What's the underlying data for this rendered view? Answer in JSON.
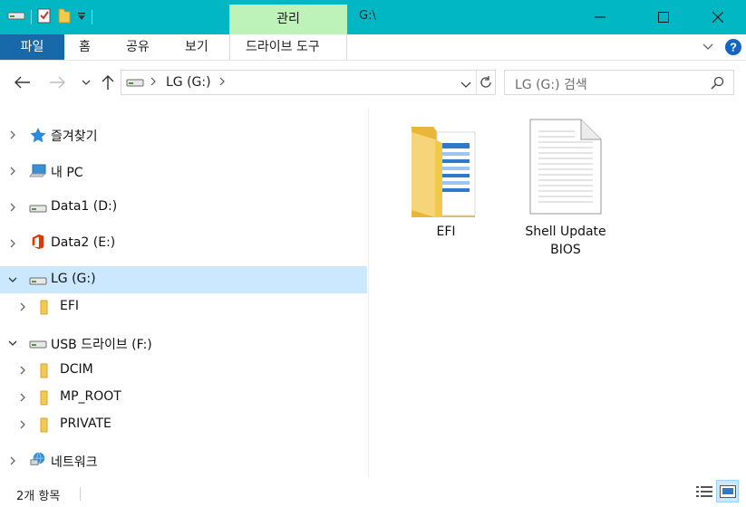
{
  "window": {
    "title": "G:\\",
    "context_tab": "관리",
    "minimize_glyph": "—",
    "maximize_glyph": "☐",
    "close_glyph": "✕"
  },
  "ribbon": {
    "file_tab": "파일",
    "tabs": [
      "홈",
      "공유",
      "보기"
    ],
    "context_subtab": "드라이브 도구"
  },
  "address": {
    "path": "LG (G:)",
    "search_placeholder": "LG (G:) 검색"
  },
  "nav": {
    "items": [
      {
        "label": "즐겨찾기",
        "icon": "star-icon",
        "expanded": false
      },
      {
        "label": "내 PC",
        "icon": "pc-icon",
        "expanded": false
      },
      {
        "label": "Data1 (D:)",
        "icon": "drive-icon",
        "expanded": false
      },
      {
        "label": "Data2 (E:)",
        "icon": "office-icon",
        "expanded": false
      },
      {
        "label": "LG (G:)",
        "icon": "drive-icon",
        "expanded": true,
        "selected": true
      },
      {
        "label": "EFI",
        "icon": "folder-icon",
        "expanded": false,
        "child": true
      },
      {
        "label": "USB 드라이브 (F:)",
        "icon": "drive-icon",
        "expanded": true
      },
      {
        "label": "DCIM",
        "icon": "folder-icon",
        "expanded": false,
        "child": true
      },
      {
        "label": "MP_ROOT",
        "icon": "folder-icon",
        "expanded": false,
        "child": true
      },
      {
        "label": "PRIVATE",
        "icon": "folder-icon",
        "expanded": false,
        "child": true
      },
      {
        "label": "네트워크",
        "icon": "network-icon",
        "expanded": false
      }
    ]
  },
  "content": {
    "files": [
      {
        "name": "EFI",
        "type": "folder"
      },
      {
        "name_line1": "Shell Update",
        "name_line2": "BIOS",
        "type": "file"
      }
    ]
  },
  "status": {
    "item_count": "2개 항목"
  },
  "colors": {
    "titlebar": "#00b7c3",
    "file_tab": "#1769aa",
    "context_tab": "#bdf2b9",
    "selection": "#cce8ff",
    "folder": "#f4c94e"
  }
}
